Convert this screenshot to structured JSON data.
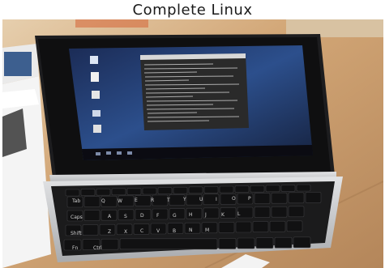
{
  "caption": "Complete Linux",
  "colors": {
    "table": "#c99c6c",
    "laptop_bezel": "#1d1d1f",
    "keyboard": "#1b1b1c",
    "aluminum": "#c9cacc",
    "desktop_blue": "#2c4f8c",
    "terminal": "#2a2a2a"
  }
}
